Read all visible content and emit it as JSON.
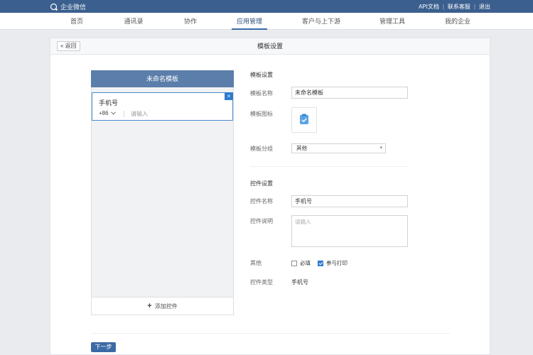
{
  "topbar": {
    "brand": "企业微信",
    "links": [
      "API文档",
      "联系客服",
      "退出"
    ]
  },
  "nav": {
    "items": [
      "首页",
      "通讯录",
      "协作",
      "应用管理",
      "客户与上下游",
      "管理工具",
      "我的企业"
    ],
    "active": "应用管理"
  },
  "page": {
    "back_label": "« 返回",
    "title": "模板设置"
  },
  "preview": {
    "header": "未命名模板",
    "control": {
      "label": "手机号",
      "country_code": "+86",
      "placeholder": "请输入",
      "close_glyph": "×"
    },
    "add_control_label": "添加控件"
  },
  "template_settings": {
    "section_title": "模板设置",
    "name_label": "模板名称",
    "name_value": "未命名模板",
    "icon_label": "模板图标",
    "group_label": "模板分组",
    "group_value": "其他"
  },
  "control_settings": {
    "section_title": "控件设置",
    "name_label": "控件名称",
    "name_value": "手机号",
    "desc_label": "控件说明",
    "desc_placeholder": "请输入",
    "other_label": "其他",
    "required_label": "必填",
    "required_checked": false,
    "print_label": "参与打印",
    "print_checked": true,
    "type_label": "控件类型",
    "type_value": "手机号"
  },
  "footer": {
    "next_label": "下一步"
  },
  "colors": {
    "topbar": "#3b5f8e",
    "accent": "#2f7ccc",
    "preview_header": "#5b7eaa"
  }
}
